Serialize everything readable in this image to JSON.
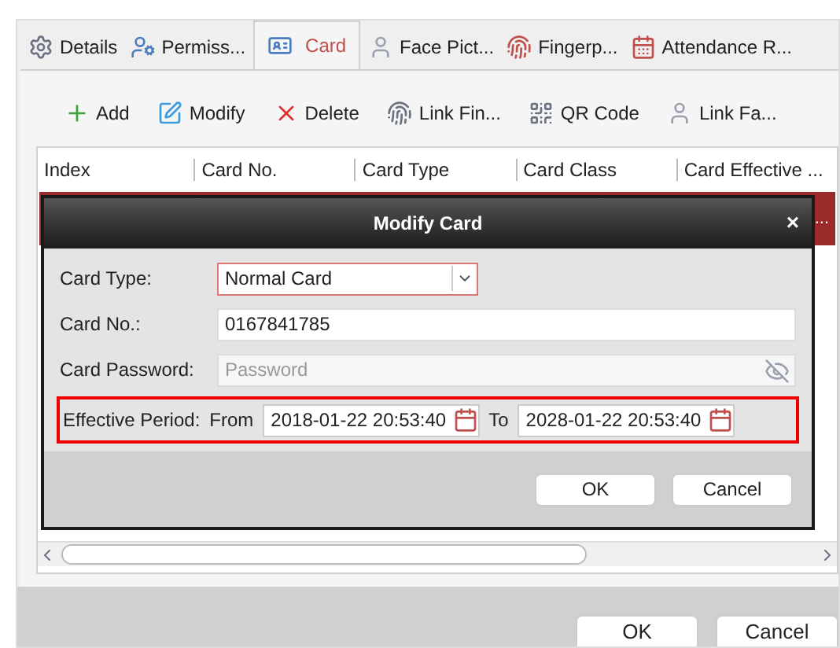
{
  "tabs": [
    {
      "label": "Details",
      "selected": false
    },
    {
      "label": "Permiss...",
      "selected": false
    },
    {
      "label": "Card",
      "selected": true
    },
    {
      "label": "Face Pict...",
      "selected": false
    },
    {
      "label": "Fingerp...",
      "selected": false
    },
    {
      "label": "Attendance R...",
      "selected": false
    }
  ],
  "toolbar": [
    {
      "label": "Add"
    },
    {
      "label": "Modify"
    },
    {
      "label": "Delete"
    },
    {
      "label": "Link Fin..."
    },
    {
      "label": "QR Code"
    },
    {
      "label": "Link Fa..."
    }
  ],
  "table": {
    "columns": [
      "Index",
      "Card No.",
      "Card Type",
      "Card Class",
      "Card Effective ..."
    ],
    "rows": [
      {
        "selected": true,
        "column_5": "..."
      }
    ]
  },
  "dialog": {
    "title": "Modify Card",
    "close": "×",
    "card_type": {
      "label": "Card Type:",
      "value": "Normal Card"
    },
    "card_no": {
      "label": "Card No.:",
      "value": "0167841785"
    },
    "card_password": {
      "label": "Card Password:",
      "placeholder": "Password"
    },
    "effective_period": {
      "label": "Effective Period:",
      "from_label": "From",
      "from": "2018-01-22 20:53:40",
      "to_label": "To",
      "to": "2028-01-22 20:53:40"
    },
    "buttons": [
      "OK",
      "Cancel"
    ]
  },
  "buttons": [
    "OK",
    "Cancel"
  ]
}
